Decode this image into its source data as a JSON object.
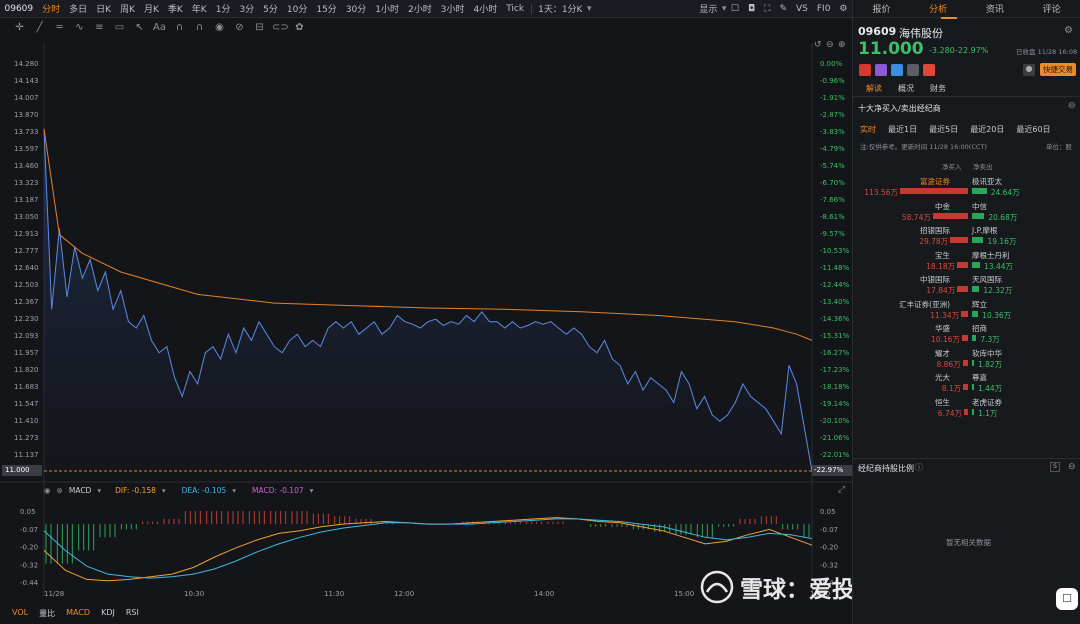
{
  "topbar": {
    "code": "09609",
    "periods": [
      "分时",
      "多日",
      "日K",
      "周K",
      "月K",
      "季K",
      "年K",
      "1分",
      "3分",
      "5分",
      "10分",
      "15分",
      "30分",
      "1小时",
      "2小时",
      "3小时",
      "4小时",
      "Tick",
      "1天：1分K"
    ],
    "display": "显示",
    "vs": "VS",
    "fib": "FI0"
  },
  "right_tabs": [
    "报价",
    "分析",
    "资讯",
    "评论"
  ],
  "stock": {
    "code": "09609",
    "name": "海伟股份",
    "price": "11.000",
    "change": "-3.280",
    "pct": "-22.97%",
    "status": "已收盘 11/28 16:08",
    "quick_trade": "快捷交易"
  },
  "sub_tabs": [
    "解读",
    "概况",
    "财务"
  ],
  "section_title": "十大净买入/卖出经纪商",
  "period_tabs": [
    "实时",
    "最近1日",
    "最近5日",
    "最近20日",
    "最近60日"
  ],
  "note": "注:仅供参考。更新时间 11/28 16:00(CCT)",
  "unit": "单位：股",
  "col_headers": {
    "buy": "净买入",
    "sell": "净卖出"
  },
  "brokers": [
    {
      "buy_name": "富途证券",
      "buy_val": "113.56万",
      "sell_name": "极讯亚太",
      "sell_val": "24.64万",
      "buy_pct": 100,
      "sell_pct": 21.7,
      "hl": true
    },
    {
      "buy_name": "中金",
      "buy_val": "58.74万",
      "sell_name": "中信",
      "sell_val": "20.68万",
      "buy_pct": 51.7,
      "sell_pct": 18.2
    },
    {
      "buy_name": "招银国际",
      "buy_val": "29.78万",
      "sell_name": "J.P.摩根",
      "sell_val": "19.16万",
      "buy_pct": 26.2,
      "sell_pct": 16.9
    },
    {
      "buy_name": "宝生",
      "buy_val": "18.18万",
      "sell_name": "摩根士丹利",
      "sell_val": "13.44万",
      "buy_pct": 16,
      "sell_pct": 11.8
    },
    {
      "buy_name": "中银国际",
      "buy_val": "17.84万",
      "sell_name": "天风国际",
      "sell_val": "12.32万",
      "buy_pct": 15.7,
      "sell_pct": 10.8
    },
    {
      "buy_name": "汇丰证券(亚洲)",
      "buy_val": "11.34万",
      "sell_name": "辉立",
      "sell_val": "10.36万",
      "buy_pct": 10,
      "sell_pct": 9.1
    },
    {
      "buy_name": "华盛",
      "buy_val": "10.16万",
      "sell_name": "招商",
      "sell_val": "7.3万",
      "buy_pct": 8.9,
      "sell_pct": 6.4
    },
    {
      "buy_name": "耀才",
      "buy_val": "8.86万",
      "sell_name": "软库中华",
      "sell_val": "1.82万",
      "buy_pct": 7.8,
      "sell_pct": 1.6
    },
    {
      "buy_name": "光大",
      "buy_val": "8.1万",
      "sell_name": "尊嘉",
      "sell_val": "1.44万",
      "buy_pct": 7.1,
      "sell_pct": 1.3
    },
    {
      "buy_name": "恒生",
      "buy_val": "6.74万",
      "sell_name": "老虎证券",
      "sell_val": "1.1万",
      "buy_pct": 5.9,
      "sell_pct": 1
    }
  ],
  "holding_title": "经纪商持股比例",
  "no_data": "暂无相关数据",
  "macd_label": {
    "name": "MACD",
    "dif": "DIF: -0.158",
    "dea": "DEA: -0.105",
    "macd": "MACD: -0.107"
  },
  "indicator_tabs": [
    "VOL",
    "量比",
    "MACD",
    "KDJ",
    "RSI"
  ],
  "watermark": "雪球：爱投资的小熊猫",
  "last_price_tag": "11.000",
  "last_pct_tag": "-22.97%",
  "colors": {
    "accent": "#f08a24",
    "up": "#e0463a",
    "down": "#3bbf6a",
    "price_line": "#5b8be6",
    "avg_line": "#e0822a",
    "bg": "#141519"
  },
  "chart_data": {
    "type": "line",
    "title": "",
    "y_left_ticks": [
      "14.280",
      "14.143",
      "14.007",
      "13.870",
      "13.733",
      "13.597",
      "13.460",
      "13.323",
      "13.187",
      "13.050",
      "12.913",
      "12.777",
      "12.640",
      "12.503",
      "12.367",
      "12.230",
      "12.093",
      "11.957",
      "11.820",
      "11.683",
      "11.547",
      "11.410",
      "11.273",
      "11.137",
      "11.000"
    ],
    "y_right_ticks": [
      "0.00%",
      "-0.96%",
      "-1.91%",
      "-2.87%",
      "-3.83%",
      "-4.79%",
      "-5.74%",
      "-6.70%",
      "-7.66%",
      "-8.61%",
      "-9.57%",
      "-10.53%",
      "-11.48%",
      "-12.44%",
      "-13.40%",
      "-14.36%",
      "-15.31%",
      "-16.27%",
      "-17.23%",
      "-18.18%",
      "-19.14%",
      "-20.10%",
      "-21.06%",
      "-22.01%",
      "-22.97%"
    ],
    "ylim": [
      11.0,
      14.28
    ],
    "x_ticks": [
      "11/28",
      "10:30",
      "11:30",
      "12:00",
      "14:00",
      "15:00",
      "16:00"
    ],
    "series": [
      {
        "name": "price",
        "x": [
          0,
          1,
          2,
          3,
          4,
          5,
          6,
          7,
          8,
          9,
          10,
          11,
          12,
          13,
          14,
          15,
          16,
          17,
          18,
          19,
          20,
          21,
          22,
          23,
          24,
          25,
          26,
          27,
          28,
          29,
          30,
          31,
          32,
          33,
          34,
          35,
          36,
          37,
          38,
          39,
          40,
          41,
          42,
          43,
          44,
          45,
          46,
          47,
          48,
          49,
          50,
          51,
          52,
          53,
          54,
          55,
          56,
          57,
          58,
          59,
          60,
          61,
          62,
          63,
          64,
          65,
          66,
          67,
          68,
          69,
          70,
          71,
          72,
          73,
          74,
          75,
          76,
          77,
          78,
          79,
          80,
          81,
          82,
          83,
          84,
          85,
          86,
          87,
          88,
          89,
          90,
          91,
          92,
          93,
          94,
          95,
          96,
          97,
          98,
          99,
          100
        ],
        "values": [
          13.75,
          12.3,
          12.95,
          12.4,
          12.8,
          12.55,
          12.7,
          12.45,
          12.6,
          12.3,
          12.45,
          12.2,
          12.15,
          12.25,
          12.05,
          11.95,
          12.0,
          11.75,
          11.6,
          11.8,
          11.7,
          11.95,
          12.0,
          11.9,
          12.1,
          11.95,
          12.15,
          12.05,
          12.2,
          12.1,
          12.0,
          11.95,
          12.05,
          12.1,
          12.0,
          12.05,
          12.0,
          12.15,
          12.2,
          12.15,
          12.2,
          12.1,
          12.15,
          12.2,
          12.1,
          12.15,
          12.25,
          12.2,
          12.18,
          12.15,
          12.2,
          12.22,
          12.17,
          12.2,
          12.18,
          12.25,
          12.2,
          12.28,
          12.2,
          12.2,
          12.15,
          12.2,
          12.15,
          12.17,
          12.2,
          12.18,
          12.2,
          12.15,
          12.1,
          12.15,
          12.1,
          12.0,
          11.95,
          12.05,
          11.9,
          11.85,
          11.7,
          11.8,
          11.65,
          11.75,
          11.7,
          11.65,
          11.55,
          11.8,
          11.7,
          11.5,
          11.6,
          11.45,
          11.4,
          11.45,
          11.55,
          11.7,
          11.6,
          11.55,
          11.5,
          11.4,
          11.3,
          11.85,
          11.7,
          11.35,
          11.0
        ]
      },
      {
        "name": "avg",
        "x": [
          0,
          2,
          5,
          10,
          20,
          30,
          40,
          50,
          60,
          70,
          80,
          90,
          95,
          98,
          100
        ],
        "values": [
          13.75,
          12.9,
          12.75,
          12.6,
          12.42,
          12.35,
          12.33,
          12.31,
          12.3,
          12.28,
          12.25,
          12.2,
          12.15,
          12.1,
          12.05
        ]
      }
    ],
    "macd": {
      "ylim": [
        -0.44,
        0.1
      ],
      "y_ticks": [
        "0.05",
        "-0.07",
        "-0.20",
        "-0.32",
        "-0.44"
      ],
      "dif": [
        -0.2,
        -0.35,
        -0.42,
        -0.43,
        -0.42,
        -0.4,
        -0.38,
        -0.33,
        -0.25,
        -0.18,
        -0.12,
        -0.07,
        -0.05,
        -0.02,
        0.0,
        0.01,
        0.02,
        0.01,
        0.0,
        0.0,
        0.01,
        0.02,
        0.03,
        0.04,
        0.05,
        0.04,
        0.02,
        0.01,
        -0.02,
        -0.05,
        -0.1,
        -0.15,
        -0.13,
        -0.08,
        -0.04,
        -0.1,
        -0.16
      ],
      "dea": [
        -0.05,
        -0.2,
        -0.32,
        -0.38,
        -0.4,
        -0.41,
        -0.4,
        -0.38,
        -0.34,
        -0.28,
        -0.21,
        -0.15,
        -0.1,
        -0.06,
        -0.03,
        -0.01,
        0.01,
        0.01,
        0.0,
        0.0,
        0.0,
        0.01,
        0.02,
        0.03,
        0.04,
        0.04,
        0.03,
        0.02,
        0.0,
        -0.02,
        -0.06,
        -0.1,
        -0.12,
        -0.1,
        -0.07,
        -0.08,
        -0.11
      ]
    }
  }
}
